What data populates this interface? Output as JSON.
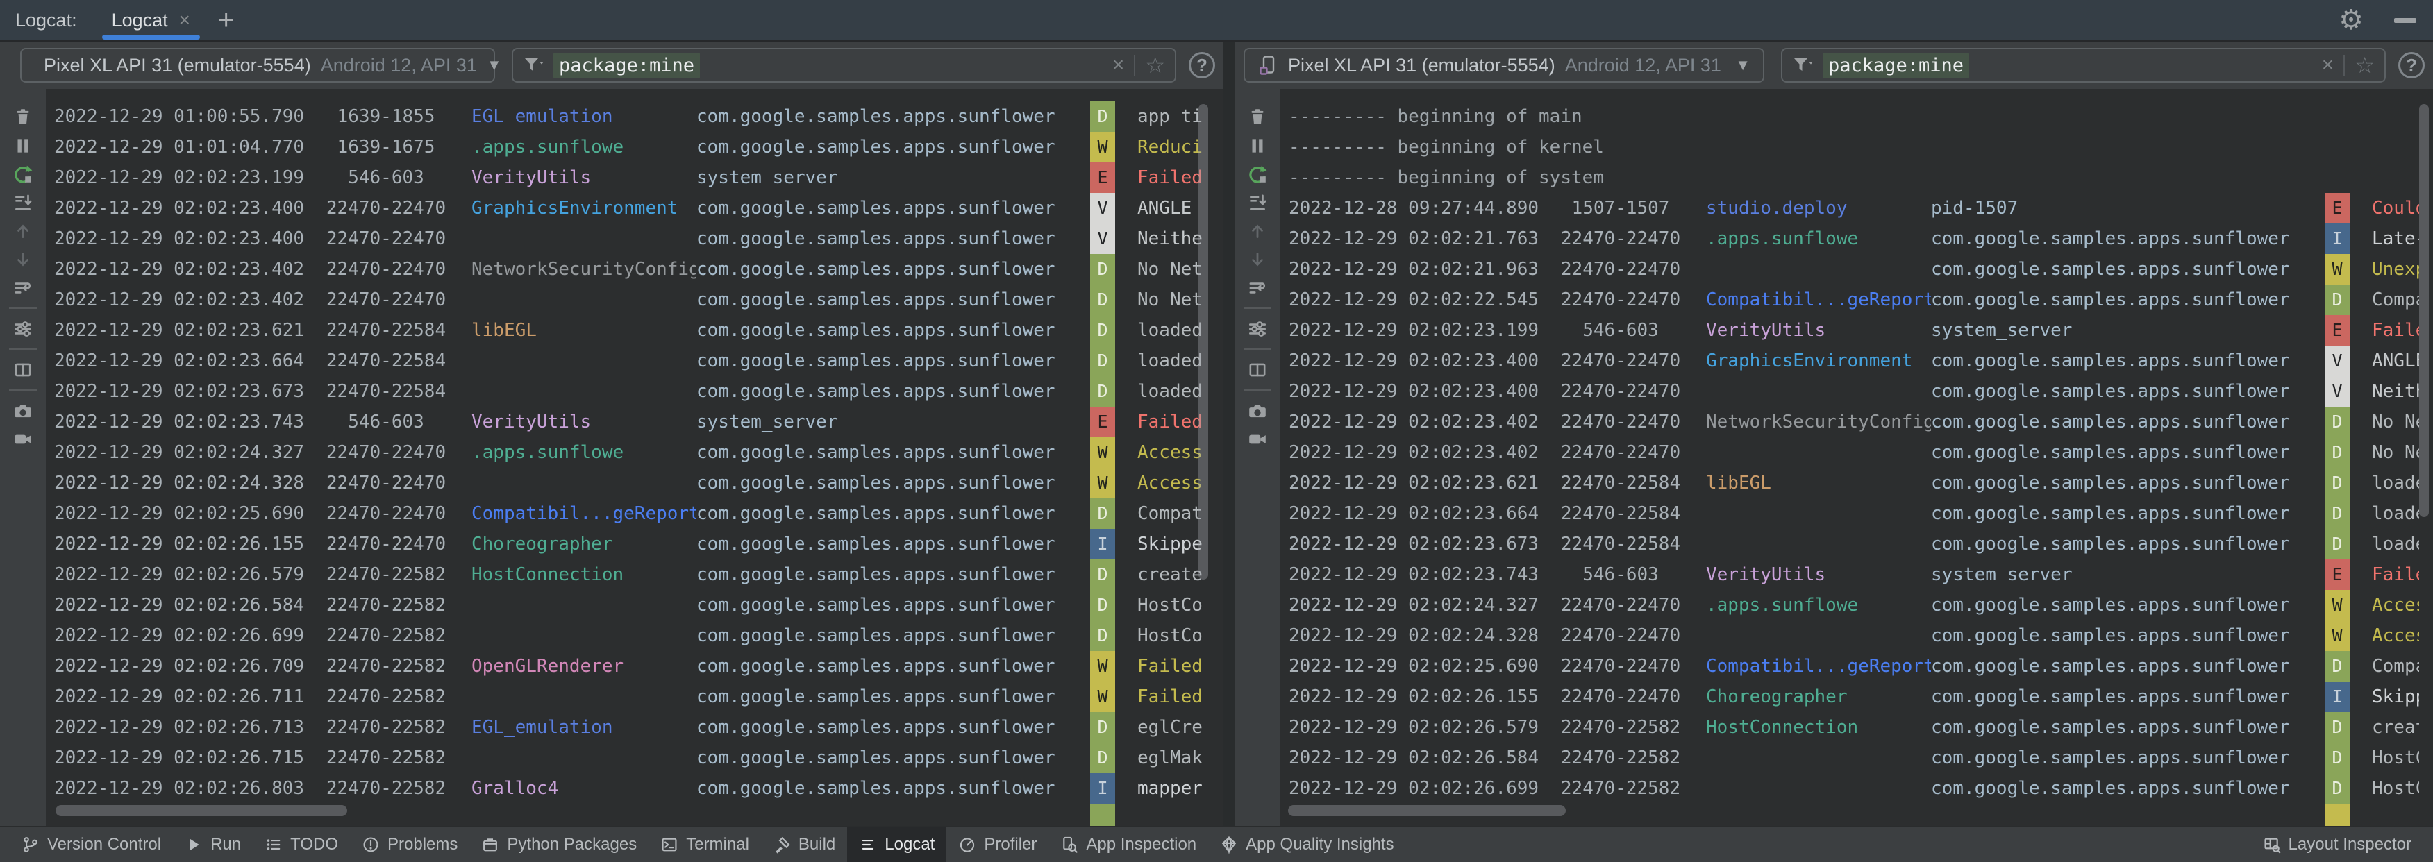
{
  "top_bar": {
    "title": "Logcat:",
    "tab_label": "Logcat",
    "close_glyph": "×",
    "add_glyph": "+"
  },
  "misc": {
    "combo_caret": "▼",
    "filter_clear": "×",
    "filter_star": "☆",
    "help": "?",
    "gear": "⚙"
  },
  "toolbar": {
    "items": [
      "clear-logcat",
      "pause-logcat",
      "restart-logcat",
      "scroll-to-end",
      "previous-occurrence",
      "next-occurrence",
      "soft-wrap",
      "sep",
      "logcat-settings",
      "sep",
      "split-panels",
      "sep",
      "screenshot",
      "screen-record"
    ]
  },
  "panels": [
    {
      "side": "left",
      "device": {
        "name": "Pixel XL API 31 (emulator-5554)",
        "detail": "Android 12, API 31"
      },
      "filter": {
        "value": "package:mine"
      },
      "partial_level": "D",
      "rows": [
        {
          "time": "2022-12-29 01:00:55.790",
          "pid": "1639-1855",
          "tag": "EGL_emulation",
          "tag_color": "#5A7FE0",
          "pkg": "com.google.samples.apps.sunflower",
          "level": "D",
          "msg": "app_ti"
        },
        {
          "time": "2022-12-29 01:01:04.770",
          "pid": "1639-1675",
          "tag": ".apps.sunflowe",
          "tag_color": "#4FAE93",
          "pkg": "com.google.samples.apps.sunflower",
          "level": "W",
          "msg": "Reduci"
        },
        {
          "time": "2022-12-29 02:02:23.199",
          "pid": "546-603",
          "tag": "VerityUtils",
          "tag_color": "#C9A2D9",
          "pkg": "system_server",
          "level": "E",
          "msg": "Failed"
        },
        {
          "time": "2022-12-29 02:02:23.400",
          "pid": "22470-22470",
          "tag": "GraphicsEnvironment",
          "tag_color": "#45A3DF",
          "pkg": "com.google.samples.apps.sunflower",
          "level": "V",
          "msg": "ANGLE "
        },
        {
          "time": "2022-12-29 02:02:23.400",
          "pid": "22470-22470",
          "tag": "",
          "tag_color": "",
          "pkg": "com.google.samples.apps.sunflower",
          "level": "V",
          "msg": "Neithe"
        },
        {
          "time": "2022-12-29 02:02:23.402",
          "pid": "22470-22470",
          "tag": "NetworkSecurityConfig",
          "tag_color": "#95999C",
          "pkg": "com.google.samples.apps.sunflower",
          "level": "D",
          "msg": "No Net"
        },
        {
          "time": "2022-12-29 02:02:23.402",
          "pid": "22470-22470",
          "tag": "",
          "tag_color": "",
          "pkg": "com.google.samples.apps.sunflower",
          "level": "D",
          "msg": "No Net"
        },
        {
          "time": "2022-12-29 02:02:23.621",
          "pid": "22470-22584",
          "tag": "libEGL",
          "tag_color": "#CB9C6A",
          "pkg": "com.google.samples.apps.sunflower",
          "level": "D",
          "msg": "loaded"
        },
        {
          "time": "2022-12-29 02:02:23.664",
          "pid": "22470-22584",
          "tag": "",
          "tag_color": "",
          "pkg": "com.google.samples.apps.sunflower",
          "level": "D",
          "msg": "loaded"
        },
        {
          "time": "2022-12-29 02:02:23.673",
          "pid": "22470-22584",
          "tag": "",
          "tag_color": "",
          "pkg": "com.google.samples.apps.sunflower",
          "level": "D",
          "msg": "loaded"
        },
        {
          "time": "2022-12-29 02:02:23.743",
          "pid": "546-603",
          "tag": "VerityUtils",
          "tag_color": "#C9A2D9",
          "pkg": "system_server",
          "level": "E",
          "msg": "Failed"
        },
        {
          "time": "2022-12-29 02:02:24.327",
          "pid": "22470-22470",
          "tag": ".apps.sunflowe",
          "tag_color": "#4FAE93",
          "pkg": "com.google.samples.apps.sunflower",
          "level": "W",
          "msg": "Access"
        },
        {
          "time": "2022-12-29 02:02:24.328",
          "pid": "22470-22470",
          "tag": "",
          "tag_color": "",
          "pkg": "com.google.samples.apps.sunflower",
          "level": "W",
          "msg": "Access"
        },
        {
          "time": "2022-12-29 02:02:25.690",
          "pid": "22470-22470",
          "tag": "Compatibil...geReporter",
          "tag_color": "#4B7EF2",
          "pkg": "com.google.samples.apps.sunflower",
          "level": "D",
          "msg": "Compat"
        },
        {
          "time": "2022-12-29 02:02:26.155",
          "pid": "22470-22470",
          "tag": "Choreographer",
          "tag_color": "#4FAE93",
          "pkg": "com.google.samples.apps.sunflower",
          "level": "I",
          "msg": "Skippe"
        },
        {
          "time": "2022-12-29 02:02:26.579",
          "pid": "22470-22582",
          "tag": "HostConnection",
          "tag_color": "#4FAE93",
          "pkg": "com.google.samples.apps.sunflower",
          "level": "D",
          "msg": "create"
        },
        {
          "time": "2022-12-29 02:02:26.584",
          "pid": "22470-22582",
          "tag": "",
          "tag_color": "",
          "pkg": "com.google.samples.apps.sunflower",
          "level": "D",
          "msg": "HostCo"
        },
        {
          "time": "2022-12-29 02:02:26.699",
          "pid": "22470-22582",
          "tag": "",
          "tag_color": "",
          "pkg": "com.google.samples.apps.sunflower",
          "level": "D",
          "msg": "HostCo"
        },
        {
          "time": "2022-12-29 02:02:26.709",
          "pid": "22470-22582",
          "tag": "OpenGLRenderer",
          "tag_color": "#D287B8",
          "pkg": "com.google.samples.apps.sunflower",
          "level": "W",
          "msg": "Failed"
        },
        {
          "time": "2022-12-29 02:02:26.711",
          "pid": "22470-22582",
          "tag": "",
          "tag_color": "",
          "pkg": "com.google.samples.apps.sunflower",
          "level": "W",
          "msg": "Failed"
        },
        {
          "time": "2022-12-29 02:02:26.713",
          "pid": "22470-22582",
          "tag": "EGL_emulation",
          "tag_color": "#5A7FE0",
          "pkg": "com.google.samples.apps.sunflower",
          "level": "D",
          "msg": "eglCre"
        },
        {
          "time": "2022-12-29 02:02:26.715",
          "pid": "22470-22582",
          "tag": "",
          "tag_color": "",
          "pkg": "com.google.samples.apps.sunflower",
          "level": "D",
          "msg": "eglMak"
        },
        {
          "time": "2022-12-29 02:02:26.803",
          "pid": "22470-22582",
          "tag": "Gralloc4",
          "tag_color": "#C9A2D9",
          "pkg": "com.google.samples.apps.sunflower",
          "level": "I",
          "msg": "mapper"
        }
      ]
    },
    {
      "side": "right",
      "device": {
        "name": "Pixel XL API 31 (emulator-5554)",
        "detail": "Android 12, API 31"
      },
      "filter": {
        "value": "package:mine"
      },
      "partial_level": "W",
      "rows": [
        {
          "marker": "--------- beginning of main"
        },
        {
          "marker": "--------- beginning of kernel"
        },
        {
          "marker": "--------- beginning of system"
        },
        {
          "time": "2022-12-28 09:27:44.890",
          "pid": "1507-1507",
          "tag": "studio.deploy",
          "tag_color": "#5A7FE0",
          "pkg": "pid-1507",
          "level": "E",
          "msg": "Could "
        },
        {
          "time": "2022-12-29 02:02:21.763",
          "pid": "22470-22470",
          "tag": ".apps.sunflowe",
          "tag_color": "#4FAE93",
          "pkg": "com.google.samples.apps.sunflower",
          "level": "I",
          "msg": "Late-e"
        },
        {
          "time": "2022-12-29 02:02:21.963",
          "pid": "22470-22470",
          "tag": "",
          "tag_color": "",
          "pkg": "com.google.samples.apps.sunflower",
          "level": "W",
          "msg": "Unexpe"
        },
        {
          "time": "2022-12-29 02:02:22.545",
          "pid": "22470-22470",
          "tag": "Compatibil...geReporter",
          "tag_color": "#4B7EF2",
          "pkg": "com.google.samples.apps.sunflower",
          "level": "D",
          "msg": "Compat"
        },
        {
          "time": "2022-12-29 02:02:23.199",
          "pid": "546-603",
          "tag": "VerityUtils",
          "tag_color": "#C9A2D9",
          "pkg": "system_server",
          "level": "E",
          "msg": "Failed"
        },
        {
          "time": "2022-12-29 02:02:23.400",
          "pid": "22470-22470",
          "tag": "GraphicsEnvironment",
          "tag_color": "#45A3DF",
          "pkg": "com.google.samples.apps.sunflower",
          "level": "V",
          "msg": "ANGLE "
        },
        {
          "time": "2022-12-29 02:02:23.400",
          "pid": "22470-22470",
          "tag": "",
          "tag_color": "",
          "pkg": "com.google.samples.apps.sunflower",
          "level": "V",
          "msg": "Neithe"
        },
        {
          "time": "2022-12-29 02:02:23.402",
          "pid": "22470-22470",
          "tag": "NetworkSecurityConfig",
          "tag_color": "#95999C",
          "pkg": "com.google.samples.apps.sunflower",
          "level": "D",
          "msg": "No Net"
        },
        {
          "time": "2022-12-29 02:02:23.402",
          "pid": "22470-22470",
          "tag": "",
          "tag_color": "",
          "pkg": "com.google.samples.apps.sunflower",
          "level": "D",
          "msg": "No Net"
        },
        {
          "time": "2022-12-29 02:02:23.621",
          "pid": "22470-22584",
          "tag": "libEGL",
          "tag_color": "#CB9C6A",
          "pkg": "com.google.samples.apps.sunflower",
          "level": "D",
          "msg": "loaded"
        },
        {
          "time": "2022-12-29 02:02:23.664",
          "pid": "22470-22584",
          "tag": "",
          "tag_color": "",
          "pkg": "com.google.samples.apps.sunflower",
          "level": "D",
          "msg": "loaded"
        },
        {
          "time": "2022-12-29 02:02:23.673",
          "pid": "22470-22584",
          "tag": "",
          "tag_color": "",
          "pkg": "com.google.samples.apps.sunflower",
          "level": "D",
          "msg": "loaded"
        },
        {
          "time": "2022-12-29 02:02:23.743",
          "pid": "546-603",
          "tag": "VerityUtils",
          "tag_color": "#C9A2D9",
          "pkg": "system_server",
          "level": "E",
          "msg": "Failed"
        },
        {
          "time": "2022-12-29 02:02:24.327",
          "pid": "22470-22470",
          "tag": ".apps.sunflowe",
          "tag_color": "#4FAE93",
          "pkg": "com.google.samples.apps.sunflower",
          "level": "W",
          "msg": "Access"
        },
        {
          "time": "2022-12-29 02:02:24.328",
          "pid": "22470-22470",
          "tag": "",
          "tag_color": "",
          "pkg": "com.google.samples.apps.sunflower",
          "level": "W",
          "msg": "Access"
        },
        {
          "time": "2022-12-29 02:02:25.690",
          "pid": "22470-22470",
          "tag": "Compatibil...geReporter",
          "tag_color": "#4B7EF2",
          "pkg": "com.google.samples.apps.sunflower",
          "level": "D",
          "msg": "Compat"
        },
        {
          "time": "2022-12-29 02:02:26.155",
          "pid": "22470-22470",
          "tag": "Choreographer",
          "tag_color": "#4FAE93",
          "pkg": "com.google.samples.apps.sunflower",
          "level": "I",
          "msg": "Skippe"
        },
        {
          "time": "2022-12-29 02:02:26.579",
          "pid": "22470-22582",
          "tag": "HostConnection",
          "tag_color": "#4FAE93",
          "pkg": "com.google.samples.apps.sunflower",
          "level": "D",
          "msg": "create"
        },
        {
          "time": "2022-12-29 02:02:26.584",
          "pid": "22470-22582",
          "tag": "",
          "tag_color": "",
          "pkg": "com.google.samples.apps.sunflower",
          "level": "D",
          "msg": "HostCo"
        },
        {
          "time": "2022-12-29 02:02:26.699",
          "pid": "22470-22582",
          "tag": "",
          "tag_color": "",
          "pkg": "com.google.samples.apps.sunflower",
          "level": "D",
          "msg": "HostCo"
        }
      ]
    }
  ],
  "status_bar": {
    "left_items": [
      {
        "icon": "version-control",
        "label": "Version Control",
        "active": false
      },
      {
        "icon": "run",
        "label": "Run",
        "active": false
      },
      {
        "icon": "todo",
        "label": "TODO",
        "active": false
      },
      {
        "icon": "problems",
        "label": "Problems",
        "active": false
      },
      {
        "icon": "python-packages",
        "label": "Python Packages",
        "active": false
      },
      {
        "icon": "terminal",
        "label": "Terminal",
        "active": false
      },
      {
        "icon": "build",
        "label": "Build",
        "active": false
      },
      {
        "icon": "logcat",
        "label": "Logcat",
        "active": true
      },
      {
        "icon": "profiler",
        "label": "Profiler",
        "active": false
      },
      {
        "icon": "app-inspection",
        "label": "App Inspection",
        "active": false
      },
      {
        "icon": "app-quality-insights",
        "label": "App Quality Insights",
        "active": false
      }
    ],
    "right_items": [
      {
        "icon": "layout-inspector",
        "label": "Layout Inspector",
        "active": false
      }
    ]
  }
}
